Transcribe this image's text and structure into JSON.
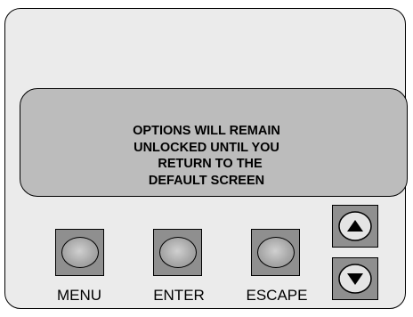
{
  "display": {
    "lines": [
      "OPTIONS WILL REMAIN",
      "UNLOCKED UNTIL YOU",
      "  RETURN TO THE",
      "DEFAULT SCREEN"
    ]
  },
  "buttons": {
    "menu_label": "MENU",
    "enter_label": "ENTER",
    "escape_label": "ESCAPE"
  },
  "icons": {
    "up": "arrow-up-icon",
    "down": "arrow-down-icon"
  }
}
